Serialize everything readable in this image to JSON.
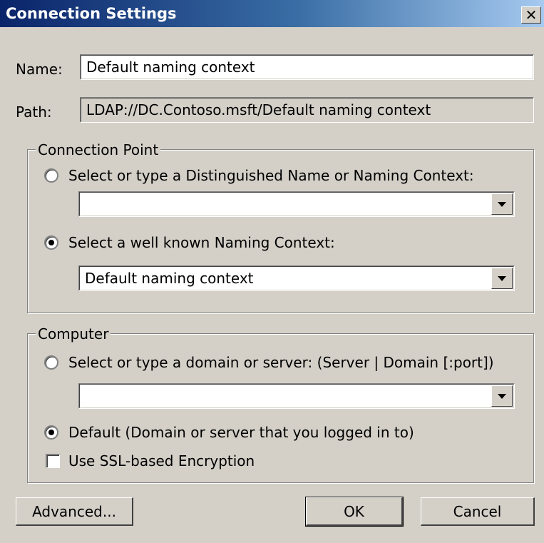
{
  "window": {
    "title": "Connection Settings",
    "close_glyph": "✕",
    "close_icon": "close-icon"
  },
  "name": {
    "label": "Name:",
    "value": "Default naming context"
  },
  "path": {
    "label": "Path:",
    "value": "LDAP://DC.Contoso.msft/Default naming context"
  },
  "connection_point": {
    "legend": "Connection Point",
    "option_dn": {
      "label": "Select or type a Distinguished Name or Naming Context:",
      "checked": false
    },
    "dn_combo_value": "",
    "option_wellknown": {
      "label": "Select a well known Naming Context:",
      "checked": true
    },
    "wellknown_combo_value": "Default naming context"
  },
  "computer": {
    "legend": "Computer",
    "option_server": {
      "label": "Select or type a domain or server: (Server | Domain [:port])",
      "checked": false
    },
    "server_combo_value": "",
    "option_default": {
      "label": "Default (Domain or server that you logged in to)",
      "checked": true
    },
    "ssl": {
      "label": "Use SSL-based Encryption",
      "checked": false
    }
  },
  "buttons": {
    "advanced": "Advanced...",
    "ok": "OK",
    "cancel": "Cancel"
  },
  "colors": {
    "dialog_bg": "#d4d0c8",
    "title_start": "#0a246a",
    "title_end": "#a6caf0"
  }
}
